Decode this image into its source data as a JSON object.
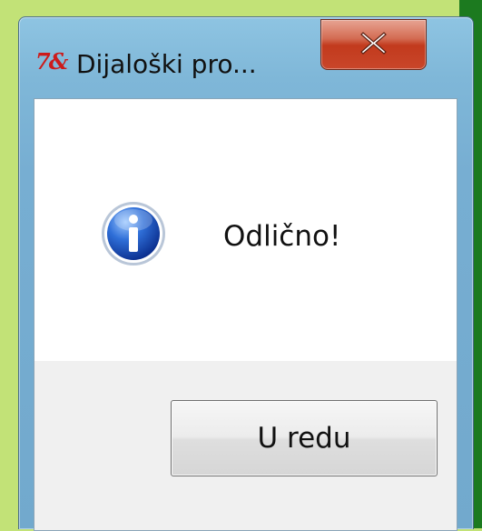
{
  "window": {
    "title": "Dijaloški pro...",
    "app_icon_text": "7&"
  },
  "dialog": {
    "message": "Odlično!",
    "ok_label": "U redu"
  },
  "icons": {
    "app": "tk-feather-icon",
    "close": "close-icon",
    "info": "information-icon"
  },
  "colors": {
    "desktop": "#c2e277",
    "titlebar": "#7fb7d8",
    "close_button": "#c23a1d",
    "client": "#ffffff",
    "button_area": "#f0f0f0",
    "info_blue": "#1f5fc8"
  }
}
